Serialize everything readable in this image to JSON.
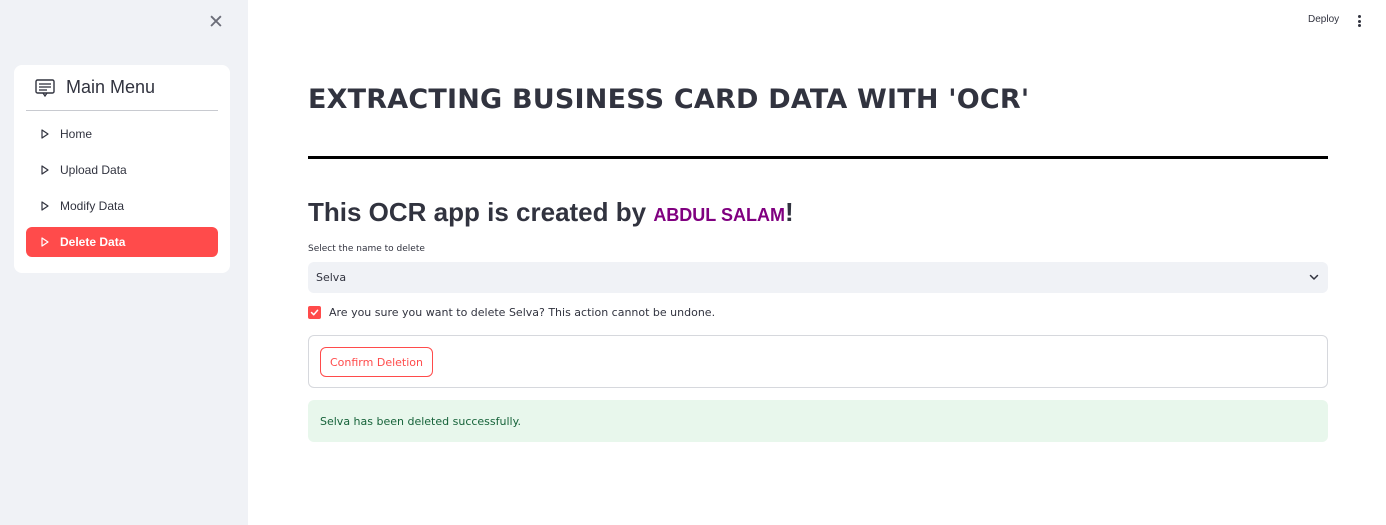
{
  "sidebar": {
    "close_glyph": "✕",
    "menu_title": "Main Menu",
    "menu_icon": "menu-card-icon",
    "items": [
      {
        "label": "Home",
        "icon": "play-outline-icon",
        "active": false
      },
      {
        "label": "Upload Data",
        "icon": "play-outline-icon",
        "active": false
      },
      {
        "label": "Modify Data",
        "icon": "play-outline-icon",
        "active": false
      },
      {
        "label": "Delete Data",
        "icon": "play-outline-icon",
        "active": true
      }
    ]
  },
  "header": {
    "deploy_label": "Deploy",
    "more_icon": "kebab-menu-icon"
  },
  "main": {
    "title": "EXTRACTING BUSINESS CARD DATA WITH 'OCR'",
    "subtitle_prefix": "This OCR app is created by ",
    "author": "ABDUL SALAM",
    "subtitle_suffix": "!",
    "select_label": "Select the name to delete",
    "select_value": "Selva",
    "confirm_checkbox_checked": true,
    "confirm_checkbox_label": "Are you sure you want to delete Selva? This action cannot be undone.",
    "confirm_button": "Confirm Deletion",
    "success_message": "Selva has been deleted successfully."
  },
  "colors": {
    "accent": "#ff4b4b",
    "author": "#800080",
    "success_bg": "#e8f7ec",
    "success_text": "#17633a",
    "sidebar_bg": "#f0f2f6"
  }
}
